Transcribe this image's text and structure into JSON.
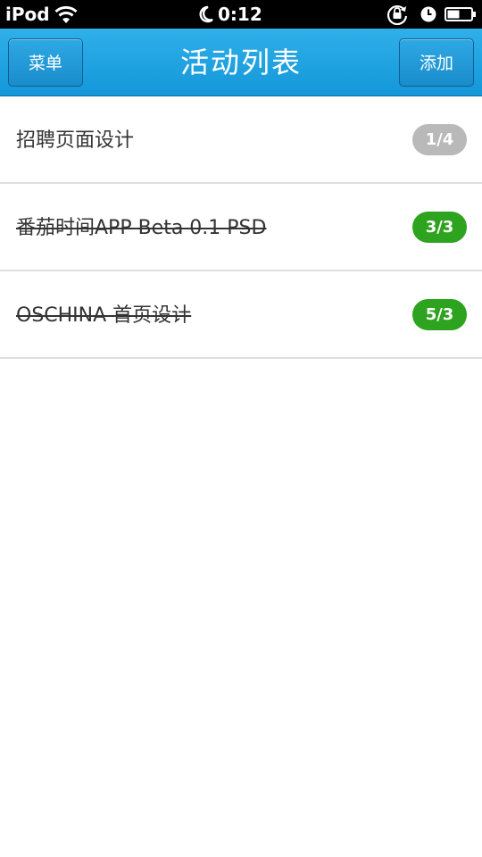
{
  "status_bar": {
    "carrier": "iPod",
    "time": "0:12",
    "icons": [
      "wifi-icon",
      "moon-icon",
      "rotation-lock-icon",
      "alarm-icon",
      "battery-icon"
    ]
  },
  "nav": {
    "menu_label": "菜单",
    "title": "活动列表",
    "add_label": "添加"
  },
  "colors": {
    "nav_blue": "#1ea3e0",
    "badge_gray": "#b9b9b9",
    "badge_green": "#2ea31f"
  },
  "activities": [
    {
      "title": "招聘页面设计",
      "count": "1/4",
      "completed": false
    },
    {
      "title": "番茄时间APP Beta 0.1 PSD",
      "count": "3/3",
      "completed": true
    },
    {
      "title": "OSCHINA 首页设计",
      "count": "5/3",
      "completed": true
    }
  ]
}
